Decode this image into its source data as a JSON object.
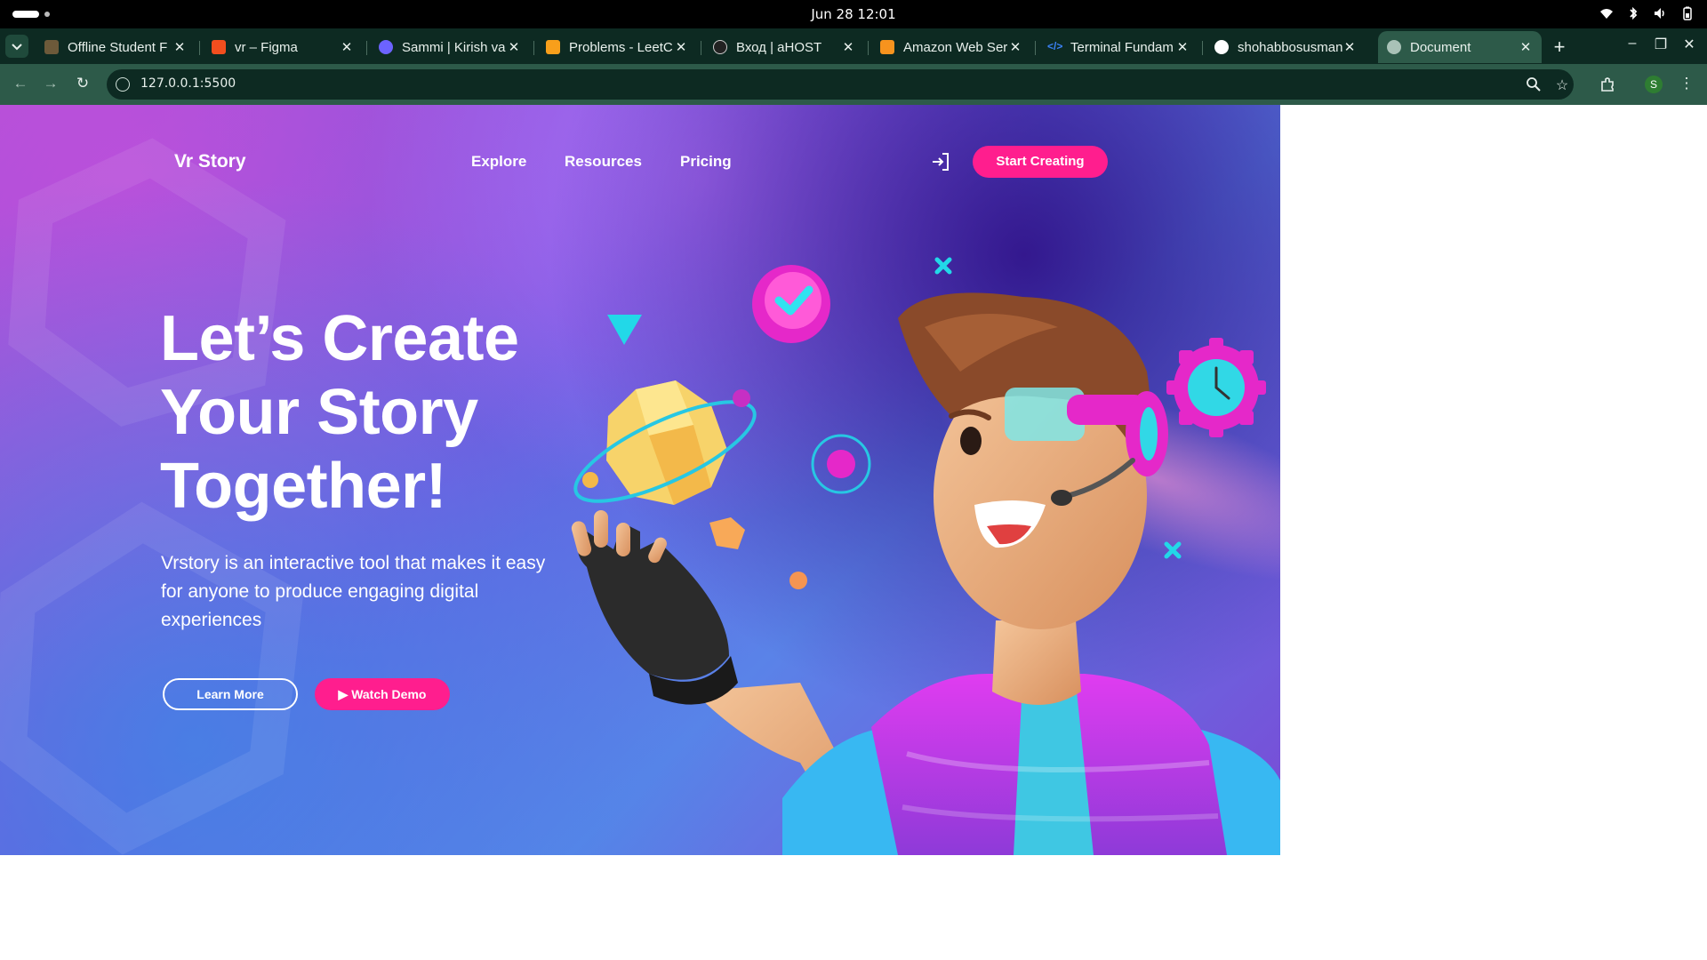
{
  "os": {
    "clock": "Jun 28  12:01"
  },
  "tabs": [
    {
      "title": "Offline Student F",
      "icon": "figma-like-icon",
      "color": "#6d5a3a"
    },
    {
      "title": "vr – Figma",
      "icon": "figma-icon",
      "color": "#f24e1e"
    },
    {
      "title": "Sammi | Kirish va",
      "icon": "course-icon",
      "color": "#6c63ff"
    },
    {
      "title": "Problems - LeetC",
      "icon": "leetcode-icon",
      "color": "#f89f1b"
    },
    {
      "title": "Вход | aHOST",
      "icon": "ahost-icon",
      "color": "#222222"
    },
    {
      "title": "Amazon Web Ser",
      "icon": "aws-icon",
      "color": "#f7931e"
    },
    {
      "title": "Terminal Fundam",
      "icon": "code-icon",
      "color": "#3b82f6"
    },
    {
      "title": "shohabbosusman",
      "icon": "github-icon",
      "color": "#ffffff"
    },
    {
      "title": "Document",
      "icon": "globe-icon",
      "color": "#a9c2b7",
      "active": true
    }
  ],
  "toolbar": {
    "url": "127.0.0.1:5500",
    "avatar_letter": "S"
  },
  "site": {
    "brand": "Vr Story",
    "nav": [
      "Explore",
      "Resources",
      "Pricing"
    ],
    "cta": "Start Creating",
    "hero_title_lines": [
      "Let’s Create",
      "Your Story",
      "Together!"
    ],
    "hero_subtitle": "Vrstory is an interactive tool that makes it easy for anyone to produce engaging digital experiences",
    "learn_more": "Learn More",
    "watch_demo": "▶ Watch Demo"
  },
  "colors": {
    "accent": "#ff1e8e",
    "browser_frame": "#2d5a49",
    "browser_dark": "#0d2a22"
  }
}
